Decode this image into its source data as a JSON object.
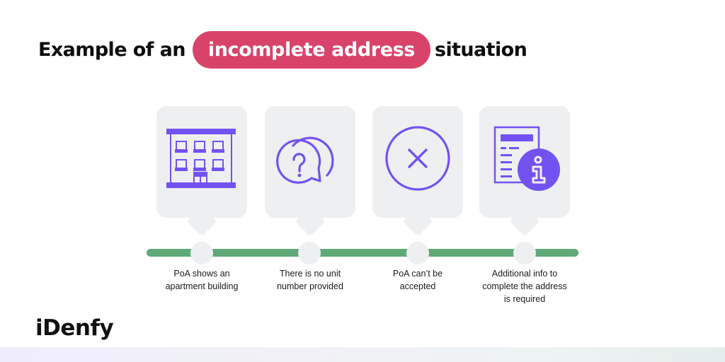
{
  "title": {
    "prefix": "Example of an",
    "highlight": "incomplete address",
    "suffix": "situation"
  },
  "colors": {
    "highlight_pill": "#d9436a",
    "icon_purple": "#7352f2",
    "timeline_green": "#5fa878",
    "card_bg": "#eeeff0"
  },
  "steps": [
    {
      "icon": "apartment-building-icon",
      "label_line1": "PoA shows an",
      "label_line2": "apartment building",
      "label_line3": ""
    },
    {
      "icon": "question-chat-bubbles-icon",
      "label_line1": "There is no unit",
      "label_line2": "number provided",
      "label_line3": ""
    },
    {
      "icon": "circle-x-icon",
      "label_line1": "PoA can’t be",
      "label_line2": "accepted",
      "label_line3": ""
    },
    {
      "icon": "document-info-icon",
      "label_line1": "Additional info to",
      "label_line2": "complete the address",
      "label_line3": "is required"
    }
  ],
  "brand": {
    "logo_text": "iDenfy"
  }
}
